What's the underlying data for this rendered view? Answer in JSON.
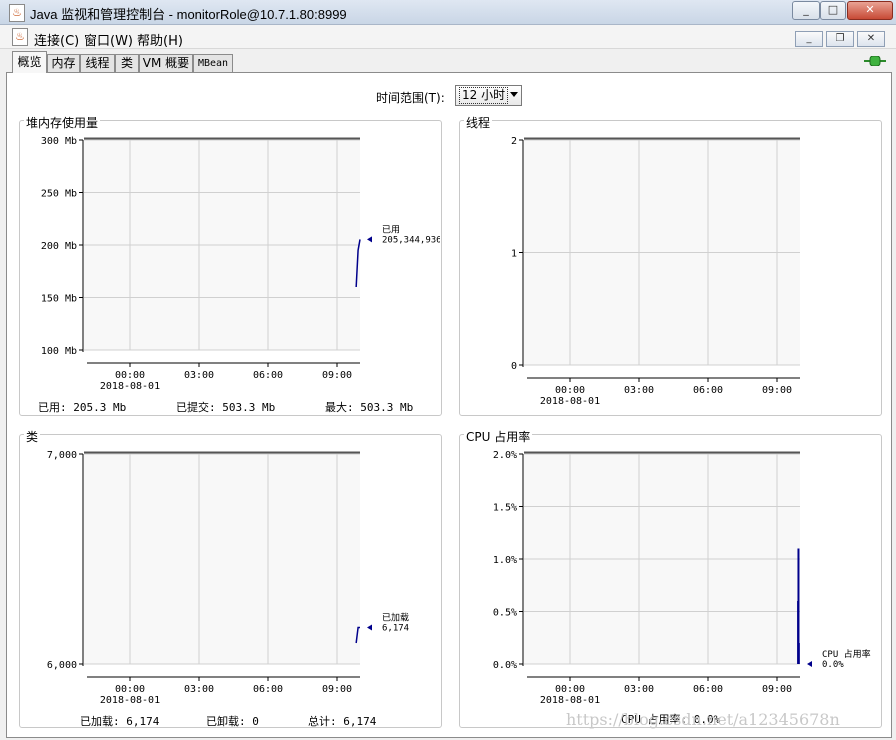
{
  "window": {
    "title": "Java 监视和管理控制台 - monitorRole@10.7.1.80:8999",
    "app_icon": "java-cup-icon"
  },
  "menu": [
    "连接(C)",
    "窗口(W)",
    "帮助(H)"
  ],
  "tabs": [
    "概览",
    "内存",
    "线程",
    "类",
    "VM 概要",
    "MBean"
  ],
  "time_range": {
    "label": "时间范围(T):",
    "value": "12 小时"
  },
  "x_ticks": [
    "00:00",
    "03:00",
    "06:00",
    "09:00"
  ],
  "x_date": "2018-08-01",
  "heap": {
    "title": "堆内存使用量",
    "y_ticks": [
      "300 Mb",
      "250 Mb",
      "200 Mb",
      "150 Mb",
      "100 Mb"
    ],
    "legend_name": "已用",
    "legend_value": "205,344,936",
    "stats": {
      "used": "已用: 205.3 Mb",
      "committed": "已提交: 503.3 Mb",
      "max": "最大: 503.3 Mb"
    }
  },
  "threads": {
    "title": "线程",
    "y_ticks": [
      "2",
      "1",
      "0"
    ]
  },
  "classes": {
    "title": "类",
    "y_ticks": [
      "7,000",
      "6,000"
    ],
    "legend_name": "已加载",
    "legend_value": "6,174",
    "stats": {
      "loaded": "已加载: 6,174",
      "unloaded": "已卸载: 0",
      "total": "总计: 6,174"
    }
  },
  "cpu": {
    "title": "CPU 占用率",
    "y_ticks": [
      "2.0%",
      "1.5%",
      "1.0%",
      "0.5%",
      "0.0%"
    ],
    "legend_name": "CPU 占用率",
    "legend_value": "0.0%",
    "stats": {
      "usage": "CPU 占用率: 0.0%"
    }
  },
  "chart_data": [
    {
      "type": "line",
      "title": "堆内存使用量",
      "ylabel": "Mb",
      "ylim": [
        100,
        300
      ],
      "x": [
        "09:50",
        "09:55",
        "10:00"
      ],
      "series": [
        {
          "name": "已用",
          "values": [
            160,
            195,
            205.3
          ]
        }
      ]
    },
    {
      "type": "line",
      "title": "线程",
      "ylim": [
        0,
        2
      ],
      "series": []
    },
    {
      "type": "line",
      "title": "类",
      "ylim": [
        6000,
        7000
      ],
      "x": [
        "09:50",
        "09:55",
        "10:00"
      ],
      "series": [
        {
          "name": "已加载",
          "values": [
            6100,
            6174,
            6174
          ]
        }
      ]
    },
    {
      "type": "line",
      "title": "CPU 占用率",
      "ylabel": "%",
      "ylim": [
        0.0,
        2.0
      ],
      "x": [
        "09:55",
        "09:56",
        "09:57",
        "09:58",
        "09:59",
        "10:00"
      ],
      "series": [
        {
          "name": "CPU 占用率",
          "values": [
            0.6,
            1.1,
            0.2,
            0.0,
            0.0,
            0.0
          ]
        }
      ]
    }
  ],
  "watermark": "https://blog.csdn.net/a12345678n",
  "colors": {
    "series": "#00008b",
    "legend_text": "#0000a0",
    "titlebar": "#d4deea"
  }
}
